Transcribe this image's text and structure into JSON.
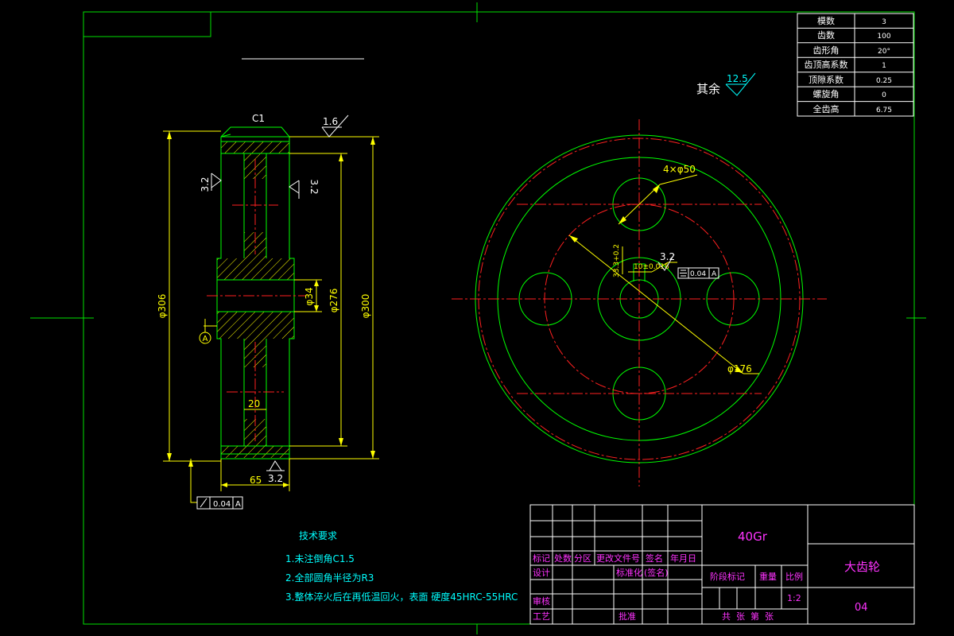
{
  "colors": {
    "background": "#000000",
    "border": "#00e000",
    "outline": "#00ff00",
    "center_line": "#ff2020",
    "dimension": "#ffff00",
    "hatch": "#ffff00",
    "table_text": "#ffffff",
    "tech_text": "#00ffff",
    "title_text": "#ff33ff"
  },
  "param_table": [
    {
      "name": "模数",
      "value": "3"
    },
    {
      "name": "齿数",
      "value": "100"
    },
    {
      "name": "齿形角",
      "value": "20°"
    },
    {
      "name": "齿顶高系数",
      "value": "1"
    },
    {
      "name": "顶隙系数",
      "value": "0.25"
    },
    {
      "name": "螺旋角",
      "value": "0"
    },
    {
      "name": "全齿高",
      "value": "6.75"
    }
  ],
  "roughness_note": {
    "prefix": "其余",
    "value": "12.5"
  },
  "section_view": {
    "chamfer": "C1",
    "roughness_top": "1.6",
    "roughness_left": "3.2",
    "roughness_right": "3.2",
    "roughness_bottom": "3.2",
    "dim_outer": "φ306",
    "dim_mid": "φ276",
    "dim_right": "φ300",
    "dim_bore": "φ34",
    "dim_web": "20",
    "dim_width": "65",
    "datum": "A",
    "runout_tol": "0.04",
    "runout_ref": "A"
  },
  "front_view": {
    "holes": "4×φ50",
    "pcd": "φ176",
    "keyway_depth": "33.3+0.2",
    "keyway_width": "10±0.018",
    "roughness": "3.2",
    "sym_tol": "0.04",
    "sym_ref": "A"
  },
  "tech_requirements": {
    "title": "技术要求",
    "items": [
      "1.未注倒角C1.5",
      "2.全部圆角半径为R3",
      "3.整体淬火后在再低温回火，表面 硬度45HRC-55HRC"
    ]
  },
  "title_block": {
    "material": "40Gr",
    "part_name": "大齿轮",
    "drawing_no": "04",
    "row_labels": [
      "标记",
      "处数",
      "分区",
      "更改文件号",
      "签名",
      "年月日"
    ],
    "design": "设计",
    "standardization": "标准化",
    "sign_name": "(签名)",
    "review": "审核",
    "process": "工艺",
    "approve": "批准",
    "stage": "阶段标记",
    "weight": "重量",
    "scale_label": "比例",
    "scale": "1:2",
    "sheets": "共  张  第  张"
  }
}
